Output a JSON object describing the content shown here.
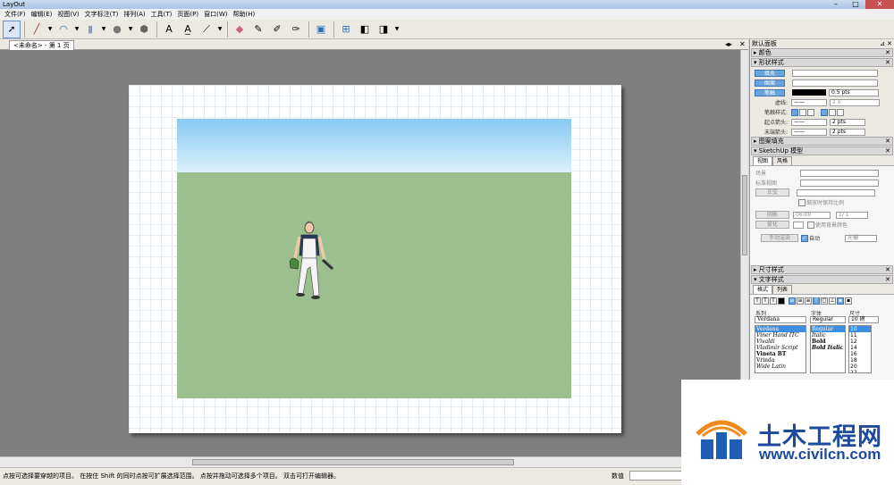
{
  "app": {
    "title": "LayOut"
  },
  "menu": [
    "文件(F)",
    "编辑(E)",
    "视图(V)",
    "文字标注(T)",
    "排列(A)",
    "工具(T)",
    "页面(P)",
    "窗口(W)",
    "帮助(H)"
  ],
  "tab": {
    "label": "<未命名> - 第 1 页"
  },
  "status": {
    "message": "点按可选择要穿越的项目。 在按住 Shift 的同时点按可扩展选择范围。 点按并拖动可选择多个项目。 双击可打开编辑器。",
    "value_label": "数值"
  },
  "panel": {
    "title": "默认面板",
    "sections": {
      "color": "颜色",
      "shape": "形状样式",
      "pattern": "图案填充",
      "sketchup": "SketchUp 模型",
      "dimension": "尺寸样式",
      "text": "文字样式"
    },
    "shape": {
      "fill": "填充",
      "pattern": "图案",
      "stroke": "笔触",
      "stroke_width": "0.5 pts",
      "dash_label": "虚线:",
      "dash_scale": "1 x",
      "stroke_style_label": "笔触样式:",
      "start_arrow_label": "起点箭头:",
      "start_arrow_size": "2 pts",
      "end_arrow_label": "末端箭头:",
      "end_arrow_size": "2 pts"
    },
    "sketchup": {
      "tab_view": "视图",
      "tab_style": "风格",
      "scene_label": "场景",
      "std_view_label": "标准视图",
      "ortho_btn": "正交",
      "keep_scale": "缩放时保持比例",
      "shadow_btn": "阴影",
      "shadow_time": "06:00",
      "shadow_date": "1/ 1",
      "fog_btn": "雾化",
      "bg_color": "使用背景颜色",
      "render_btn": "手动渲染",
      "auto": "自动",
      "raster": "光栅"
    },
    "text": {
      "tab_format": "格式",
      "tab_list": "列表",
      "family_label": "系列",
      "typeface_label": "字体",
      "size_label": "尺寸",
      "family_value": "Verdana",
      "typeface_value": "Regular",
      "size_value": "10 磅",
      "families": [
        "Verdana",
        "Viner Hand ITC",
        "Vivaldi",
        "Vladimir Script",
        "Vineta BT",
        "Vrinda",
        "Wide Latin"
      ],
      "typefaces": [
        "Regular",
        "Italic",
        "Bold",
        "Bold Italic"
      ],
      "sizes": [
        "10",
        "11",
        "12",
        "14",
        "16",
        "18",
        "20",
        "22"
      ]
    }
  },
  "watermark": {
    "name": "土木工程网",
    "url": "www.civilcn.com"
  },
  "colors": {
    "accent": "#6aa4dc",
    "sky": "#86c9f2",
    "ground": "#9cbf8f",
    "brand": "#1e4a9e"
  }
}
